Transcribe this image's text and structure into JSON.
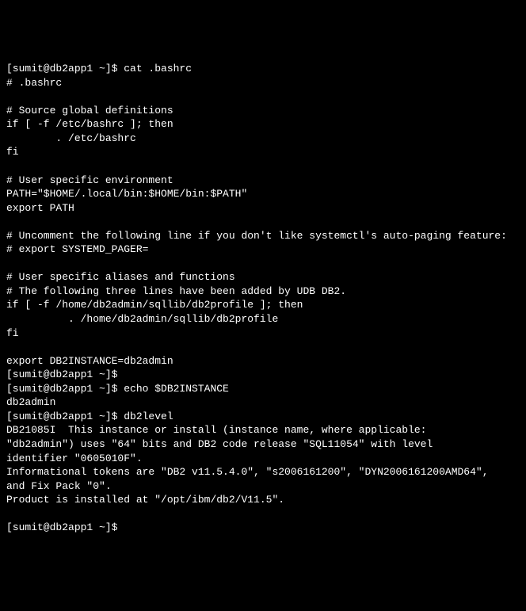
{
  "lines": {
    "l0": "[sumit@db2app1 ~]$ cat .bashrc",
    "l1": "# .bashrc",
    "l2": "",
    "l3": "# Source global definitions",
    "l4": "if [ -f /etc/bashrc ]; then",
    "l5": "        . /etc/bashrc",
    "l6": "fi",
    "l7": "",
    "l8": "# User specific environment",
    "l9": "PATH=\"$HOME/.local/bin:$HOME/bin:$PATH\"",
    "l10": "export PATH",
    "l11": "",
    "l12": "# Uncomment the following line if you don't like systemctl's auto-paging feature:",
    "l13": "# export SYSTEMD_PAGER=",
    "l14": "",
    "l15": "# User specific aliases and functions",
    "l16": "# The following three lines have been added by UDB DB2.",
    "l17": "if [ -f /home/db2admin/sqllib/db2profile ]; then",
    "l18": "          . /home/db2admin/sqllib/db2profile",
    "l19": "fi",
    "l20": "",
    "l21": "export DB2INSTANCE=db2admin",
    "l22": "[sumit@db2app1 ~]$",
    "l23": "[sumit@db2app1 ~]$ echo $DB2INSTANCE",
    "l24": "db2admin",
    "l25": "[sumit@db2app1 ~]$ db2level",
    "l26": "DB21085I  This instance or install (instance name, where applicable:",
    "l27": "\"db2admin\") uses \"64\" bits and DB2 code release \"SQL11054\" with level",
    "l28": "identifier \"0605010F\".",
    "l29": "Informational tokens are \"DB2 v11.5.4.0\", \"s2006161200\", \"DYN2006161200AMD64\",",
    "l30": "and Fix Pack \"0\".",
    "l31": "Product is installed at \"/opt/ibm/db2/V11.5\".",
    "l32": "",
    "l33": "[sumit@db2app1 ~]$"
  }
}
